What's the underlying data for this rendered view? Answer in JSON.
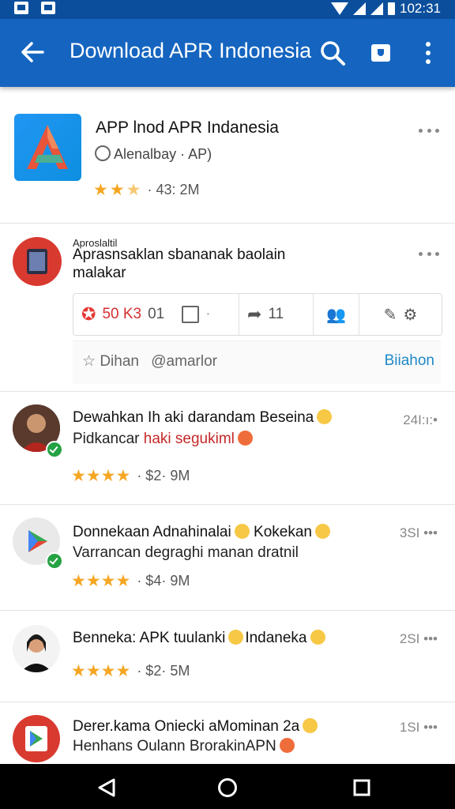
{
  "status_bar": {
    "time": "102:31"
  },
  "app_bar": {
    "title": "Download APR Indonesia"
  },
  "app_card": {
    "name": "APP lnod APR Indanesia",
    "developer": "Alenalbay · AP)",
    "rating_meta": "· 43: 2M"
  },
  "post": {
    "header_small": "Aproslaltil",
    "text_line1": "Aprasnsaklan sbananak baolain",
    "text_line2": "malakar",
    "actions": {
      "likes": "50 K3",
      "likes_extra": "01",
      "share_count": "11"
    },
    "footer_left1": "Dihan",
    "footer_left2": "@amarlor",
    "footer_right": "Biiahon"
  },
  "feed": [
    {
      "title": "Dewahkan Ih aki darandam Beseina",
      "line2a": "Pidkancar",
      "line2b": "haki segukiml",
      "stars": "★★★★",
      "meta": "· $2· 9M",
      "time": "24I:ı:•"
    },
    {
      "title": "Donnekaan Adnahinalai",
      "title_b": "Kokekan",
      "line2a": "Varrancan degraghi manan dratnil",
      "stars": "★★★★",
      "meta": "· $4· 9M",
      "time": "3SI •••"
    },
    {
      "title": "Benneka: APK tuulanki",
      "title_b": "Indaneka",
      "stars": "★★★★",
      "meta": "· $2· 5M",
      "time": "2SI •••"
    },
    {
      "title": "Derer.kama Oniecki aMominan 2a",
      "line2a": "Henhans Oulann BrorakinAPN",
      "time": "1SI •••"
    }
  ],
  "colors": {
    "app_bar": "#1565c0",
    "status_bar": "#0b4f9c",
    "star": "#f5a623",
    "link": "#1e88c8"
  },
  "icons": [
    "back-arrow-icon",
    "search-icon",
    "shield-icon",
    "more-vert-icon",
    "back-nav-icon",
    "home-nav-icon",
    "recents-nav-icon"
  ]
}
